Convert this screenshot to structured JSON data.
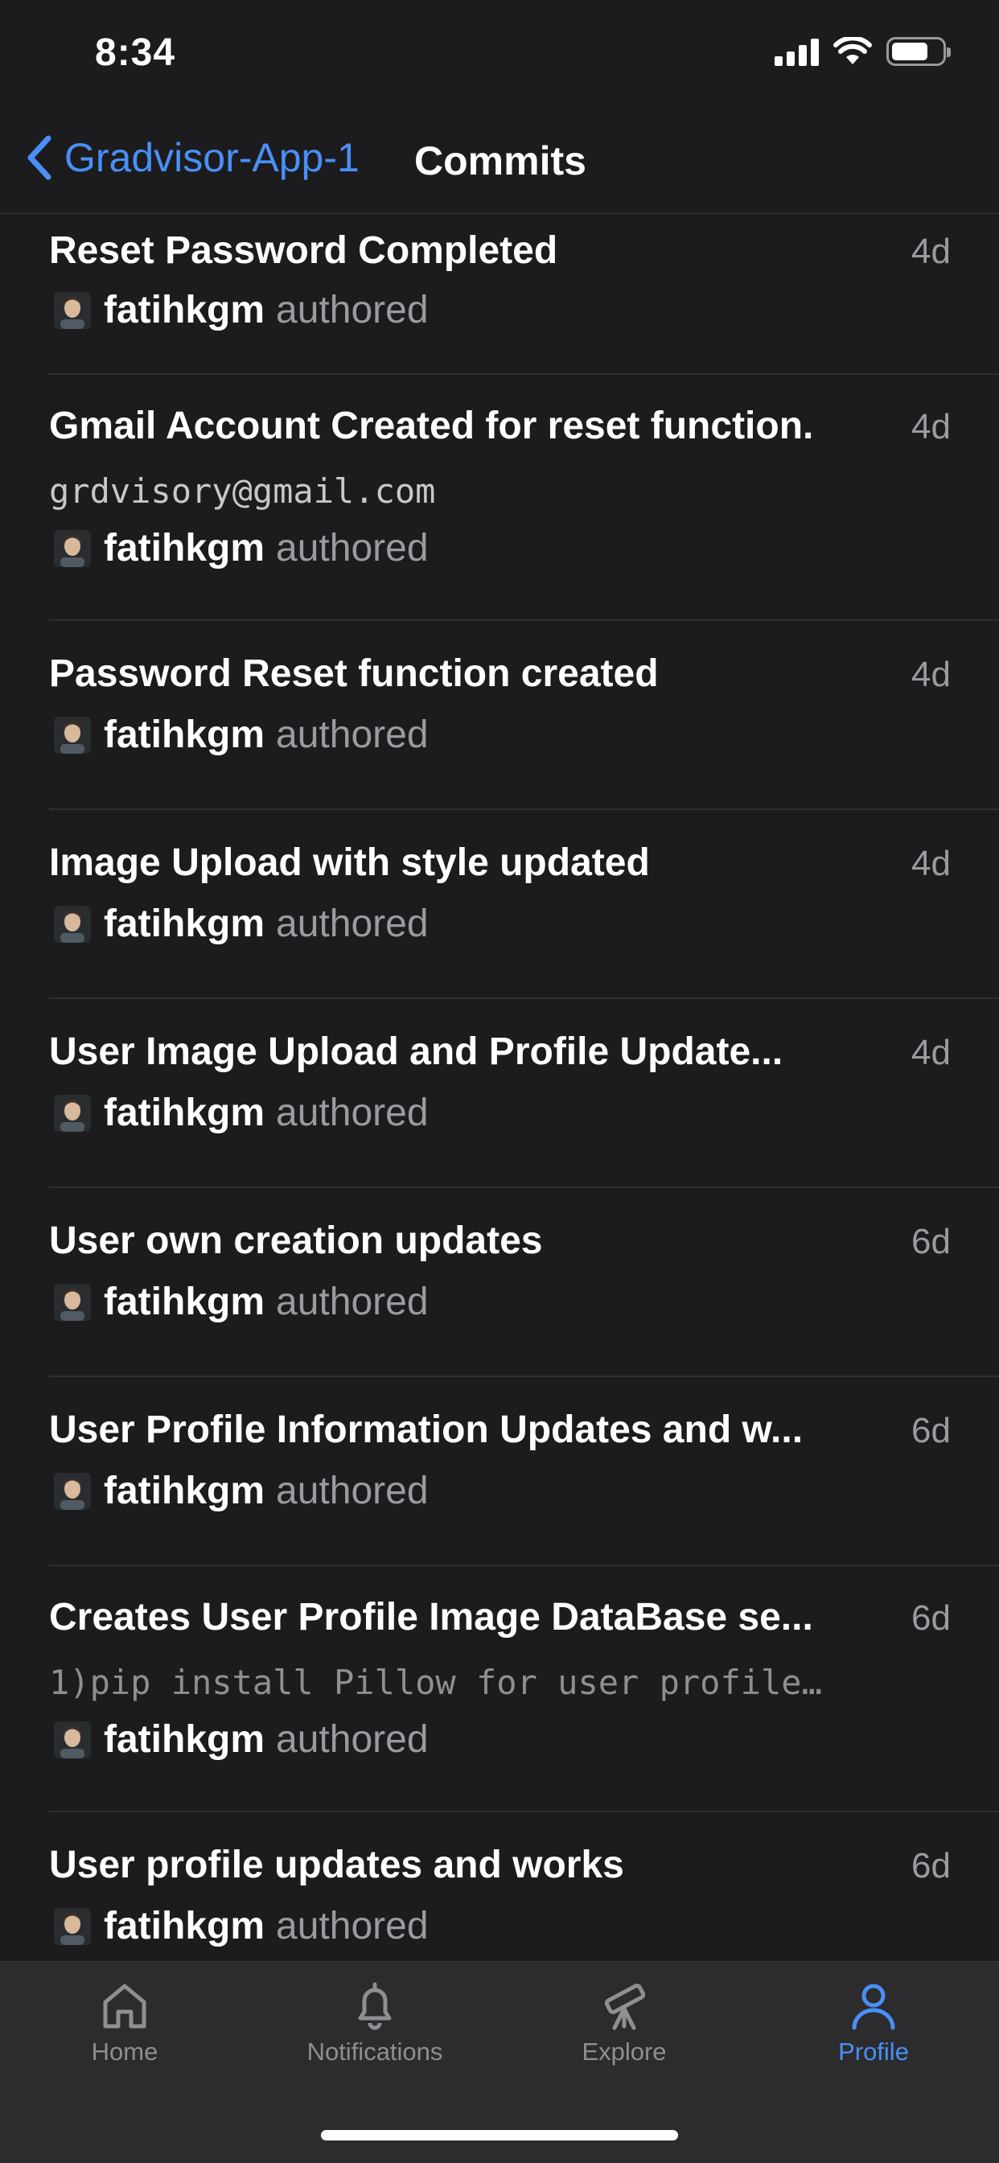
{
  "status_bar": {
    "time": "8:34"
  },
  "nav": {
    "back_label": "Gradvisor-App-1",
    "title": "Commits"
  },
  "commits": [
    {
      "title": "Reset Password Completed",
      "age": "4d",
      "author": "fatihkgm",
      "action": "authored"
    },
    {
      "title": "Gmail Account Created for reset function.",
      "body": "grdvisory@gmail.com",
      "age": "4d",
      "author": "fatihkgm",
      "action": "authored"
    },
    {
      "title": "Password Reset function created",
      "age": "4d",
      "author": "fatihkgm",
      "action": "authored"
    },
    {
      "title": "Image Upload with style updated",
      "age": "4d",
      "author": "fatihkgm",
      "action": "authored"
    },
    {
      "title": "User Image Upload and Profile Update...",
      "age": "4d",
      "author": "fatihkgm",
      "action": "authored"
    },
    {
      "title": "User own creation updates",
      "age": "6d",
      "author": "fatihkgm",
      "action": "authored"
    },
    {
      "title": "User Profile Information Updates and w...",
      "age": "6d",
      "author": "fatihkgm",
      "action": "authored"
    },
    {
      "title": "Creates User Profile Image DataBase se...",
      "body": "1)pip install Pillow  for user profile…",
      "age": "6d",
      "author": "fatihkgm",
      "action": "authored"
    },
    {
      "title": "User profile updates and works",
      "age": "6d",
      "author": "fatihkgm",
      "action": "authored"
    }
  ],
  "tabs": [
    {
      "label": "Home",
      "icon": "home-icon"
    },
    {
      "label": "Notifications",
      "icon": "bell-icon"
    },
    {
      "label": "Explore",
      "icon": "telescope-icon"
    },
    {
      "label": "Profile",
      "icon": "person-icon",
      "active": true
    }
  ],
  "colors": {
    "background": "#1c1c1e",
    "accent": "#4a8ff7",
    "secondary_text": "#9a9aa0",
    "tab_bar": "#2c2c2e"
  }
}
